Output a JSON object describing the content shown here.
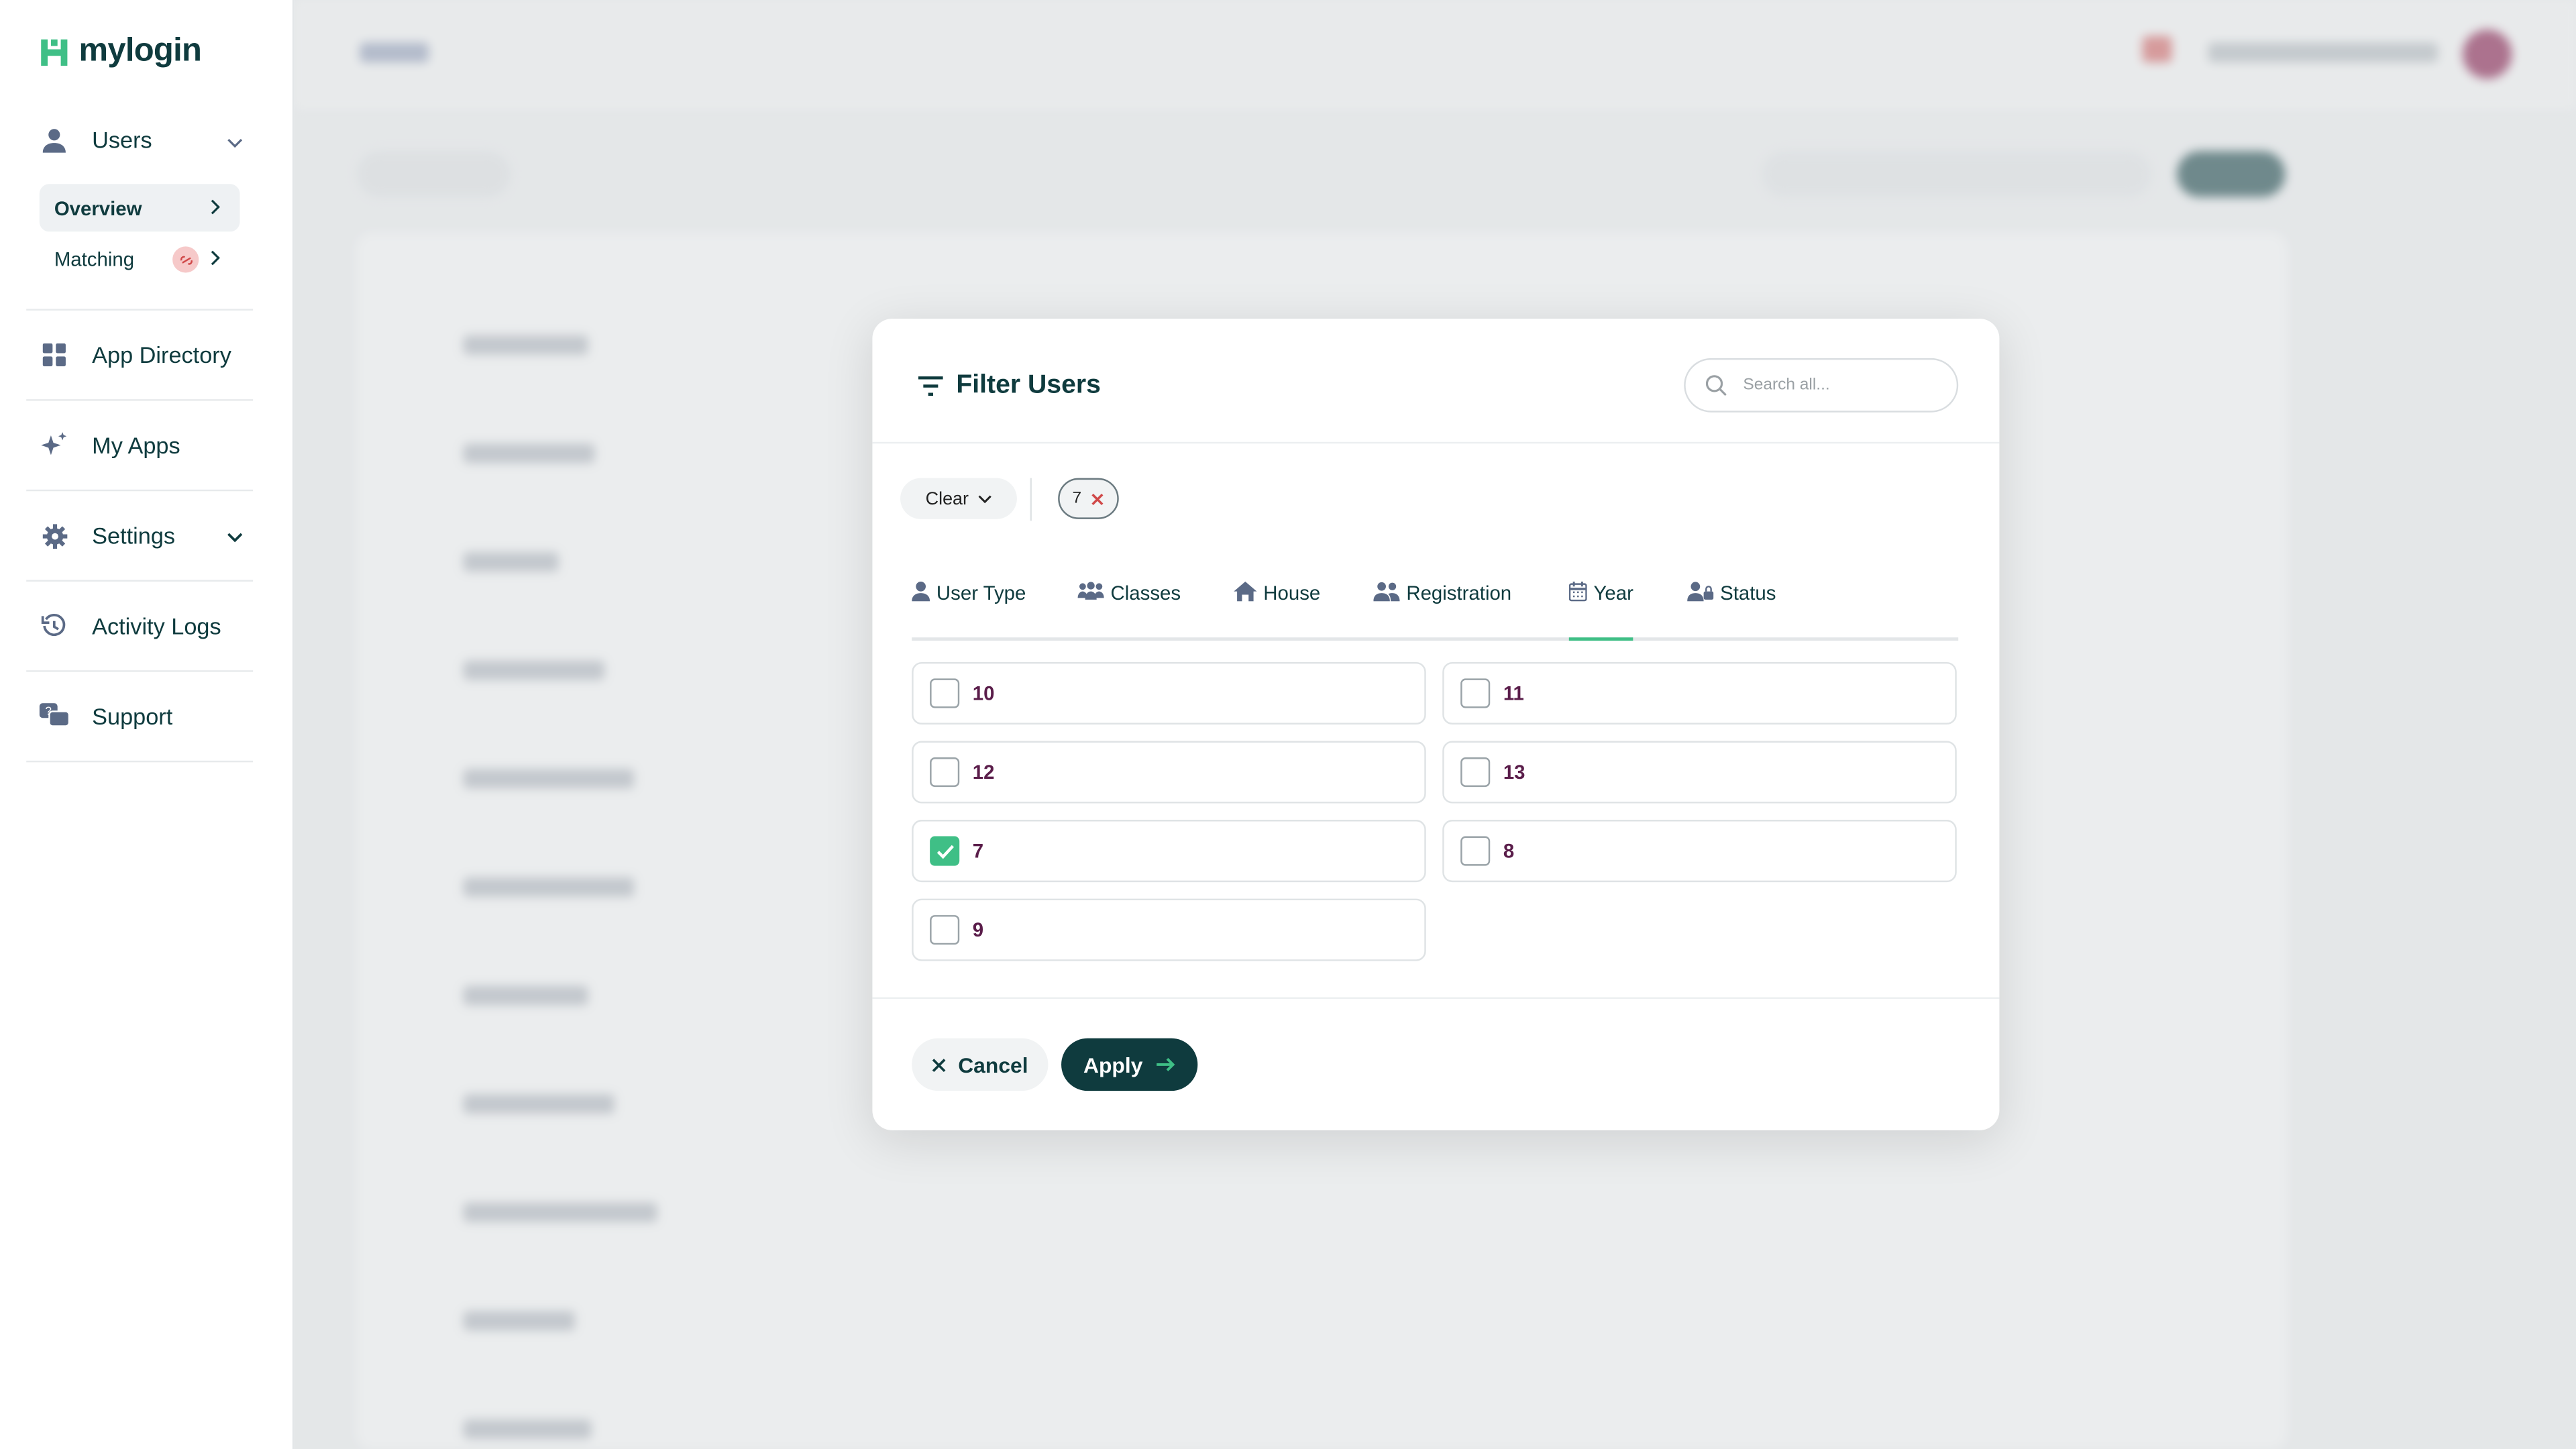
{
  "app": {
    "name": "mylogin"
  },
  "sidebar": {
    "users_label": "Users",
    "overview_label": "Overview",
    "matching_label": "Matching",
    "items": [
      {
        "label": "App Directory",
        "icon": "grid-icon"
      },
      {
        "label": "My Apps",
        "icon": "sparkle-icon"
      },
      {
        "label": "Settings",
        "icon": "gear-icon"
      },
      {
        "label": "Activity Logs",
        "icon": "history-icon"
      },
      {
        "label": "Support",
        "icon": "support-chat-icon"
      }
    ]
  },
  "modal": {
    "title": "Filter Users",
    "search_placeholder": "Search all...",
    "clear_label": "Clear",
    "active_chip": "7",
    "tabs": [
      {
        "label": "User Type",
        "icon": "person-icon"
      },
      {
        "label": "Classes",
        "icon": "group-icon"
      },
      {
        "label": "House",
        "icon": "house-icon"
      },
      {
        "label": "Registration",
        "icon": "people-icon"
      },
      {
        "label": "Year",
        "icon": "calendar-icon",
        "active": true
      },
      {
        "label": "Status",
        "icon": "user-lock-icon"
      }
    ],
    "options": [
      {
        "label": "10",
        "checked": false
      },
      {
        "label": "11",
        "checked": false
      },
      {
        "label": "12",
        "checked": false
      },
      {
        "label": "13",
        "checked": false
      },
      {
        "label": "7",
        "checked": true
      },
      {
        "label": "8",
        "checked": false
      },
      {
        "label": "9",
        "checked": false
      }
    ],
    "cancel_label": "Cancel",
    "apply_label": "Apply"
  },
  "colors": {
    "brand_dark": "#0f3b3e",
    "accent_green": "#3fbf86",
    "option_text": "#5a1d4a"
  }
}
